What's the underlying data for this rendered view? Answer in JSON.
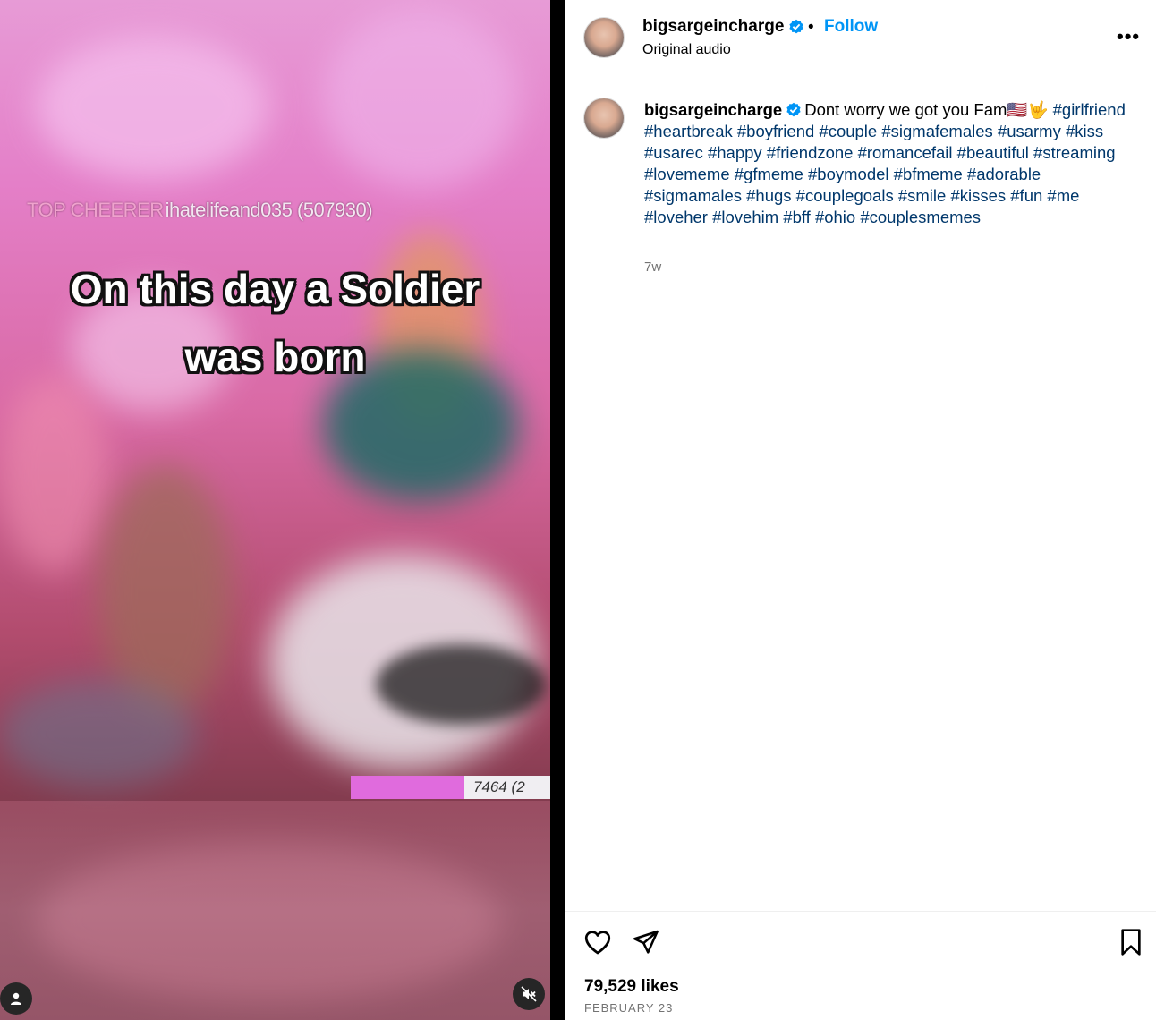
{
  "video": {
    "top_cheerer_tag": "TOP CHEERER",
    "top_cheerer_text": "ihatelifeand035 (507930)",
    "caption_line1": "On this day a Soldier",
    "caption_line2": "was born",
    "counter": "7464 (2"
  },
  "post": {
    "username": "bigsargeincharge",
    "follow_label": "Follow",
    "separator": "•",
    "audio": "Original audio",
    "more_label": "•••",
    "caption_text": "Dont worry we got you Fam🇺🇸🤟",
    "hashtags": "#girlfriend #heartbreak #boyfriend #couple #sigmafemales #usarmy #kiss #usarec #happy #friendzone #romancefail #beautiful #streaming #lovememe #gfmeme #boymodel #bfmeme #adorable #sigmamales #hugs #couplegoals #smile #kisses #fun #me #loveher #lovehim #bff #ohio #couplesmemes",
    "age": "7w",
    "likes": "79,529 likes",
    "date": "FEBRUARY 23"
  },
  "colors": {
    "link": "#0095f6",
    "hashtag": "#00376b",
    "muted": "#737373"
  }
}
